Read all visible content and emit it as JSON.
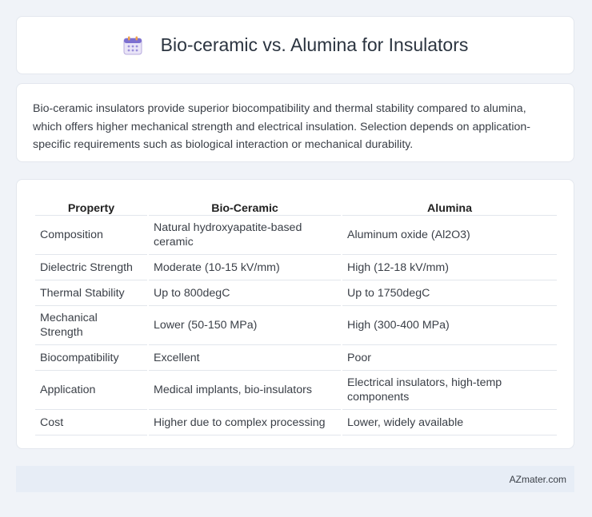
{
  "title": "Bio-ceramic vs. Alumina for Insulators",
  "summary": "Bio-ceramic insulators provide superior biocompatibility and thermal stability compared to alumina, which offers higher mechanical strength and electrical insulation. Selection depends on application-specific requirements such as biological interaction or mechanical durability.",
  "table": {
    "headers": [
      "Property",
      "Bio-Ceramic",
      "Alumina"
    ],
    "rows": [
      [
        "Composition",
        "Natural hydroxyapatite-based ceramic",
        "Aluminum oxide (Al2O3)"
      ],
      [
        "Dielectric Strength",
        "Moderate (10-15 kV/mm)",
        "High (12-18 kV/mm)"
      ],
      [
        "Thermal Stability",
        "Up to 800degC",
        "Up to 1750degC"
      ],
      [
        "Mechanical Strength",
        "Lower (50-150 MPa)",
        "High (300-400 MPa)"
      ],
      [
        "Biocompatibility",
        "Excellent",
        "Poor"
      ],
      [
        "Application",
        "Medical implants, bio-insulators",
        "Electrical insulators, high-temp components"
      ],
      [
        "Cost",
        "Higher due to complex processing",
        "Lower, widely available"
      ]
    ]
  },
  "footer": "AZmater.com",
  "icon": "calendar-icon"
}
